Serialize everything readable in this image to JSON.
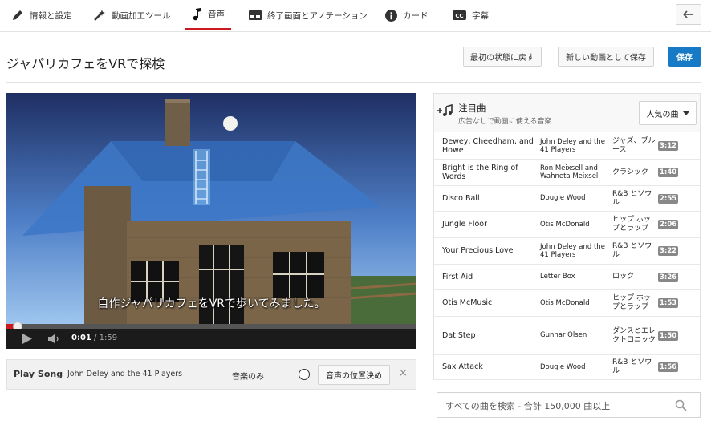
{
  "tabs": [
    {
      "label": "情報と設定",
      "icon": "pencil-icon"
    },
    {
      "label": "動画加工ツール",
      "icon": "magic-wand-icon"
    },
    {
      "label": "音声",
      "icon": "music-note-icon",
      "active": true
    },
    {
      "label": "終了画面とアノテーション",
      "icon": "end-screen-icon"
    },
    {
      "label": "カード",
      "icon": "info-icon"
    },
    {
      "label": "字幕",
      "icon": "cc-icon"
    }
  ],
  "header": {
    "title": "ジャパリカフェをVRで探検",
    "revert_label": "最初の状態に戻す",
    "save_new_label": "新しい動画として保存",
    "save_label": "保存"
  },
  "player": {
    "subtitle": "自作ジャパリカフェをVRで歩いてみました。",
    "current_time": "0:01",
    "duration": "1:59",
    "progress": 0.008
  },
  "songbar": {
    "label": "Play Song",
    "artist": "John Deley and the 41 Players",
    "music_only_label": "音楽のみ",
    "position_button": "音声の位置決め",
    "close": "×"
  },
  "panel": {
    "title": "注目曲",
    "subtitle": "広告なしで動画に使える音楽",
    "sort_label": "人気の曲"
  },
  "tracks": [
    {
      "title": "Dewey, Cheedham, and Howe",
      "artist": "John Deley and the 41 Players",
      "genre": "ジャズ、ブルース",
      "duration": "3:12"
    },
    {
      "title": "Bright is the Ring of Words",
      "artist": "Ron Meixsell and Wahneta Meixsell",
      "genre": "クラシック",
      "duration": "1:40"
    },
    {
      "title": "Disco Ball",
      "artist": "Dougie Wood",
      "genre": "R&B とソウル",
      "duration": "2:55"
    },
    {
      "title": "Jungle Floor",
      "artist": "Otis McDonald",
      "genre": "ヒップ ホップとラップ",
      "duration": "2:06"
    },
    {
      "title": "Your Precious Love",
      "artist": "John Deley and the 41 Players",
      "genre": "R&B とソウル",
      "duration": "3:22"
    },
    {
      "title": "First Aid",
      "artist": "Letter Box",
      "genre": "ロック",
      "duration": "3:26"
    },
    {
      "title": "Otis McMusic",
      "artist": "Otis McDonald",
      "genre": "ヒップ ホップとラップ",
      "duration": "1:53"
    },
    {
      "title": "Dat Step",
      "artist": "Gunnar Olsen",
      "genre": "ダンスとエレクトロニック",
      "duration": "1:50"
    },
    {
      "title": "Sax Attack",
      "artist": "Dougie Wood",
      "genre": "R&B とソウル",
      "duration": "1:56"
    }
  ],
  "search": {
    "placeholder": "すべての曲を検索 - 合計 150,000 曲以上"
  },
  "colors": {
    "accent_red": "#cc181e",
    "primary_blue": "#167ac6"
  }
}
